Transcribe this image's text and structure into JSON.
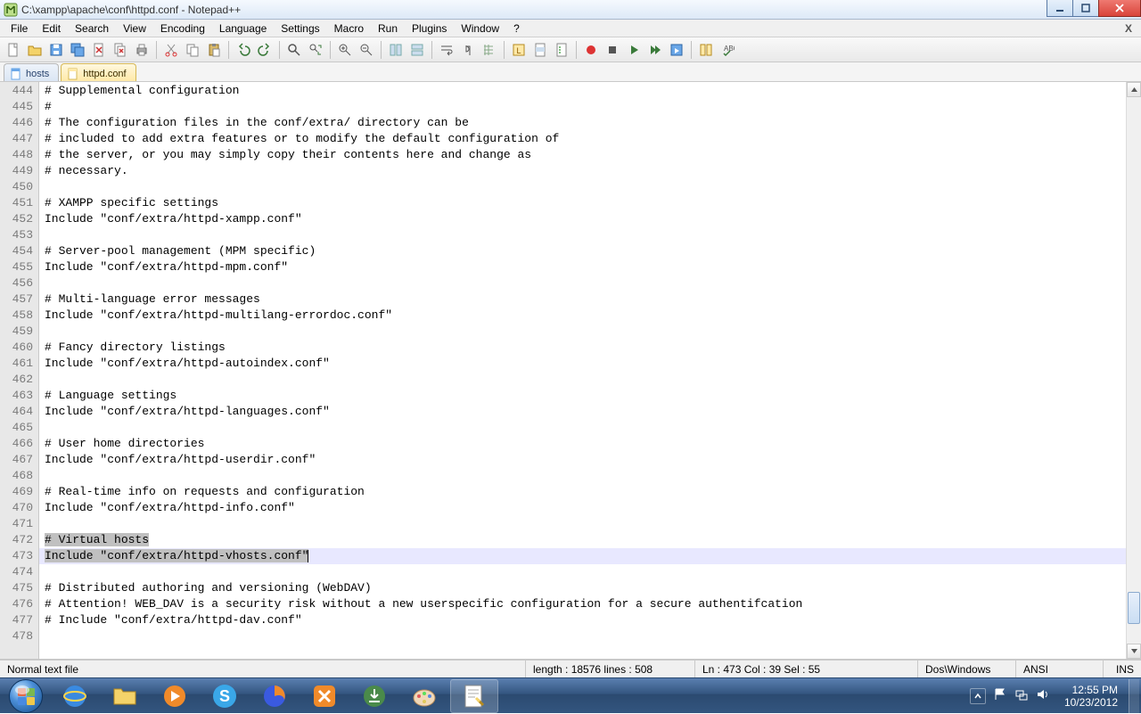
{
  "window": {
    "title": "C:\\xampp\\apache\\conf\\httpd.conf - Notepad++"
  },
  "menus": [
    "File",
    "Edit",
    "Search",
    "View",
    "Encoding",
    "Language",
    "Settings",
    "Macro",
    "Run",
    "Plugins",
    "Window",
    "?"
  ],
  "menu_close": "X",
  "tabs": [
    {
      "label": "hosts",
      "active": false
    },
    {
      "label": "httpd.conf",
      "active": true
    }
  ],
  "editor": {
    "first_line_no": 444,
    "current_line_index": 29,
    "selection_line_index_a": 28,
    "lines": [
      "# Supplemental configuration",
      "#",
      "# The configuration files in the conf/extra/ directory can be",
      "# included to add extra features or to modify the default configuration of",
      "# the server, or you may simply copy their contents here and change as",
      "# necessary.",
      "",
      "# XAMPP specific settings",
      "Include \"conf/extra/httpd-xampp.conf\"",
      "",
      "# Server-pool management (MPM specific)",
      "Include \"conf/extra/httpd-mpm.conf\"",
      "",
      "# Multi-language error messages",
      "Include \"conf/extra/httpd-multilang-errordoc.conf\"",
      "",
      "# Fancy directory listings",
      "Include \"conf/extra/httpd-autoindex.conf\"",
      "",
      "# Language settings",
      "Include \"conf/extra/httpd-languages.conf\"",
      "",
      "# User home directories",
      "Include \"conf/extra/httpd-userdir.conf\"",
      "",
      "# Real-time info on requests and configuration",
      "Include \"conf/extra/httpd-info.conf\"",
      "",
      "# Virtual hosts",
      "Include \"conf/extra/httpd-vhosts.conf\"",
      "",
      "# Distributed authoring and versioning (WebDAV)",
      "# Attention! WEB_DAV is a security risk without a new userspecific configuration for a secure authentifcation",
      "# Include \"conf/extra/httpd-dav.conf\"",
      ""
    ]
  },
  "status": {
    "filetype": "Normal text file",
    "length_lines": "length : 18576    lines : 508",
    "pos": "Ln : 473   Col : 39   Sel : 55",
    "eol": "Dos\\Windows",
    "encoding": "ANSI",
    "mode": "INS"
  },
  "tray": {
    "time": "12:55 PM",
    "date": "10/23/2012"
  }
}
